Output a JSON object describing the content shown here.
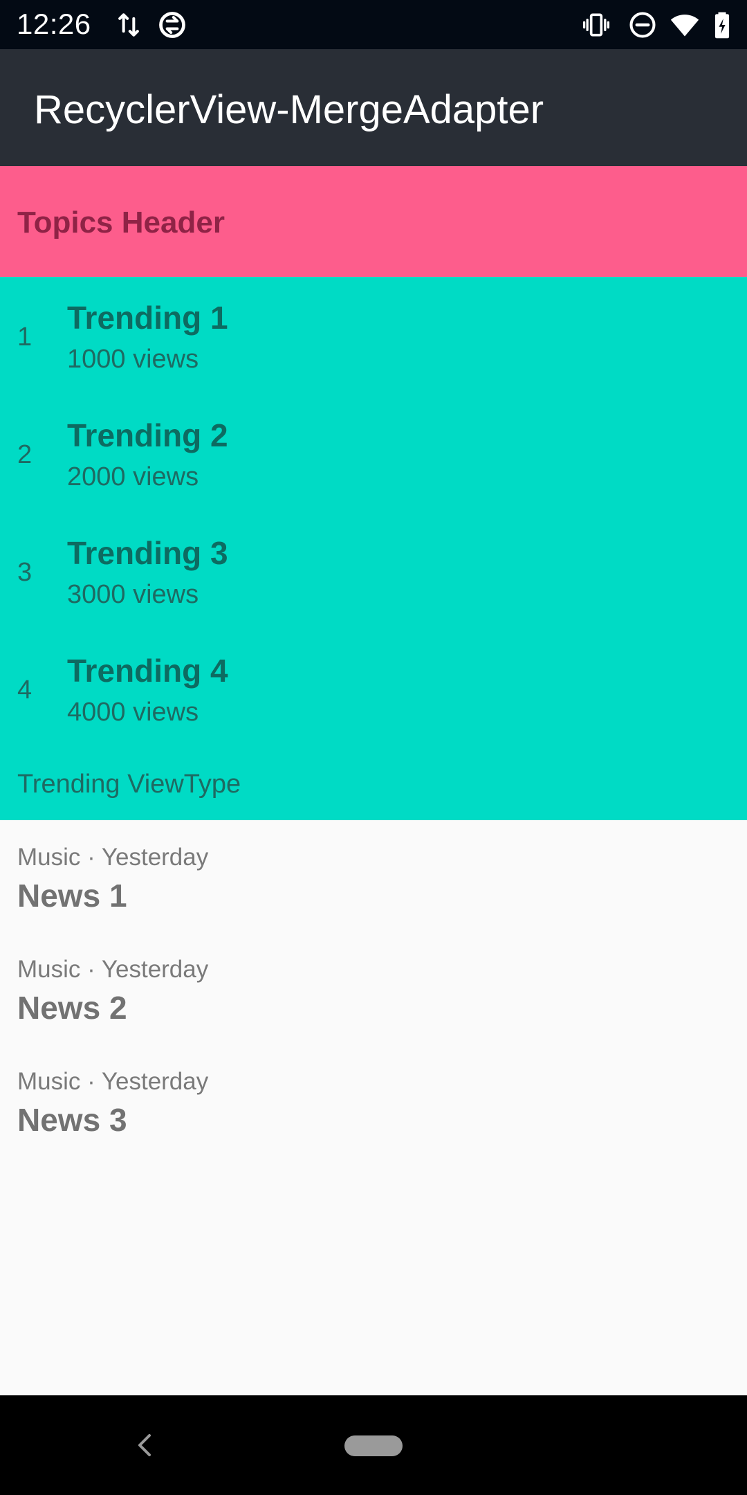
{
  "status_bar": {
    "time": "12:26",
    "icons": [
      "data-transfer-icon",
      "sync-icon",
      "vibrate-icon",
      "do-not-disturb-icon",
      "wifi-icon",
      "battery-icon"
    ]
  },
  "app_bar": {
    "title": "RecyclerView-MergeAdapter"
  },
  "topics": {
    "header": "Topics Header"
  },
  "trending": {
    "items": [
      {
        "rank": "1",
        "title": "Trending 1",
        "views": "1000 views"
      },
      {
        "rank": "2",
        "title": "Trending 2",
        "views": "2000 views"
      },
      {
        "rank": "3",
        "title": "Trending 3",
        "views": "3000 views"
      },
      {
        "rank": "4",
        "title": "Trending 4",
        "views": "4000 views"
      }
    ],
    "footer": "Trending ViewType"
  },
  "news": {
    "items": [
      {
        "meta": "Music · Yesterday",
        "title": "News 1"
      },
      {
        "meta": "Music · Yesterday",
        "title": "News 2"
      },
      {
        "meta": "Music · Yesterday",
        "title": "News 3"
      }
    ]
  },
  "nav_bar": {
    "icons": [
      "back-icon",
      "home-pill-icon"
    ]
  },
  "colors": {
    "status_bar": "#030a14",
    "app_bar": "#292e36",
    "topics_header": "#fd5d8c",
    "trending_bg": "#00dbc5",
    "page_bg": "#fafafa"
  }
}
